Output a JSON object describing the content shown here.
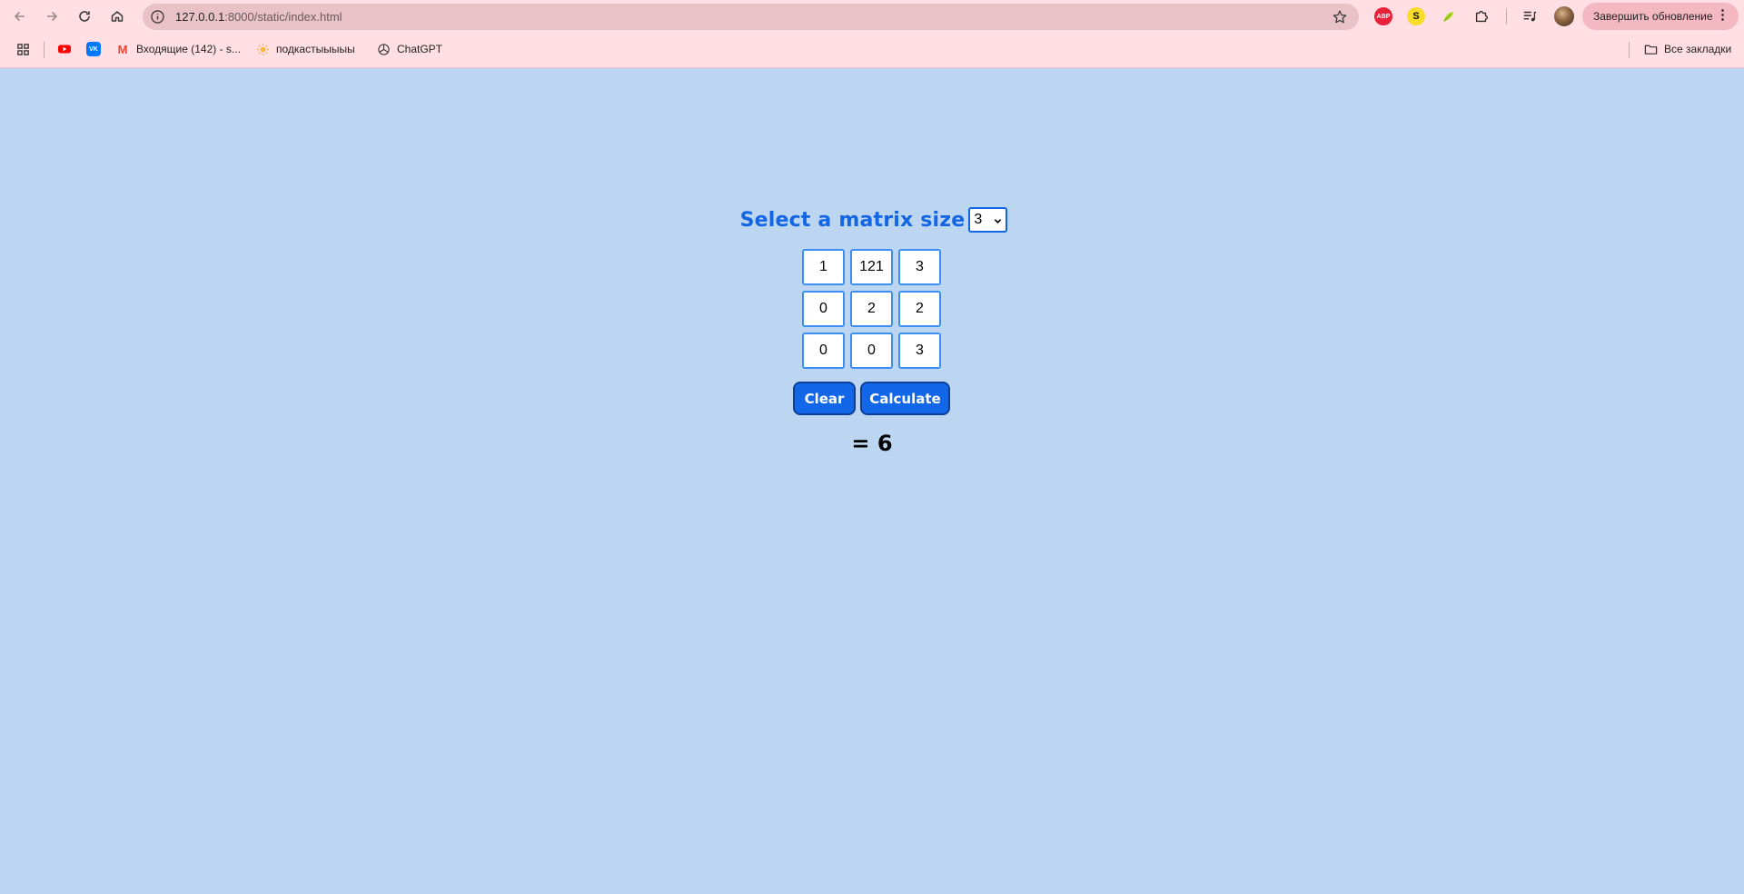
{
  "browser": {
    "url_host": "127.0.0.1",
    "url_rest": ":8000/static/index.html",
    "update_button_label": "Завершить обновление",
    "extensions": [
      "abp-icon",
      "s-extension-icon",
      "leaf-icon",
      "puzzle-icon",
      "media-icon"
    ],
    "extension_abp_label": "ABP",
    "extension_s_label": "S"
  },
  "bookmarks": {
    "items": [
      {
        "icon": "youtube-icon",
        "label": ""
      },
      {
        "icon": "vk-icon",
        "label": ""
      },
      {
        "icon": "gmail-icon",
        "label": "Входящие (142) - s..."
      },
      {
        "icon": "sun-icon",
        "label": "подкастыыыыы"
      },
      {
        "icon": "chatgpt-icon",
        "label": "ChatGPT"
      }
    ],
    "all_bookmarks_label": "Все закладки",
    "vk_glyph": "VK",
    "gmail_glyph": "M"
  },
  "page": {
    "title": "Select a matrix size",
    "size_selected": "3",
    "matrix": [
      [
        "1",
        "121",
        "3"
      ],
      [
        "0",
        "2",
        "2"
      ],
      [
        "0",
        "0",
        "3"
      ]
    ],
    "clear_label": "Clear",
    "calculate_label": "Calculate",
    "result": "= 6"
  },
  "colors": {
    "page_background": "#bcd5f1",
    "accent": "#1266e4",
    "chrome_background": "#ffdfe4"
  }
}
